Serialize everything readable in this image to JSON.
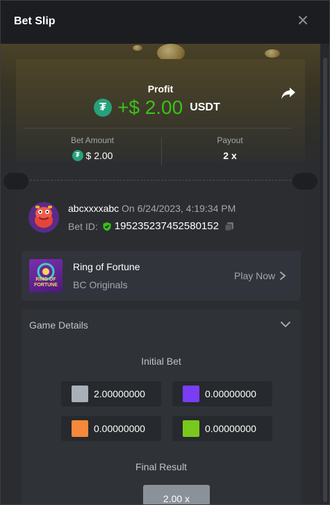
{
  "header": {
    "title": "Bet Slip"
  },
  "profit": {
    "label": "Profit",
    "amount": "+$ 2.00",
    "currency": "USDT"
  },
  "stats": {
    "bet_amount_label": "Bet Amount",
    "bet_amount_value": "$ 2.00",
    "payout_label": "Payout",
    "payout_value": "2 x"
  },
  "user": {
    "name": "abcxxxxabc",
    "on_date": "On 6/24/2023, 4:19:34 PM",
    "bet_id_label": "Bet ID:",
    "bet_id": "195235237452580152"
  },
  "game": {
    "name": "Ring of Fortune",
    "provider": "BC Originals",
    "play_now": "Play Now",
    "thumb_text": "RING OF FORTUNE"
  },
  "details": {
    "title": "Game Details",
    "initial_bet_label": "Initial Bet",
    "bets": [
      {
        "value": "2.00000000",
        "color": "#aab0b8"
      },
      {
        "value": "0.00000000",
        "color": "#7a3cf5"
      },
      {
        "value": "0.00000000",
        "color": "#f5883a"
      },
      {
        "value": "0.00000000",
        "color": "#7ac81e"
      }
    ],
    "final_result_label": "Final Result",
    "final_result": "2.00 x"
  },
  "colors": {
    "profit_green": "#3bc117",
    "tether_green": "#26a17b",
    "verified_green": "#3bc117"
  },
  "icons": {
    "close": "close-icon",
    "share": "share-icon",
    "tether": "tether-icon",
    "shield": "shield-check-icon",
    "copy": "copy-icon",
    "chevron_right": "chevron-right-icon",
    "chevron_down": "chevron-down-icon"
  }
}
